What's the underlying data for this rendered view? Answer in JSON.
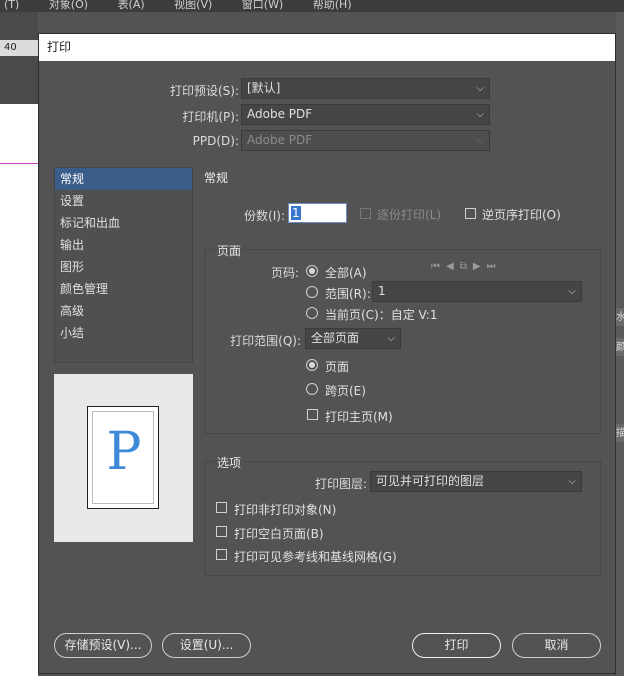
{
  "background": {
    "menu": [
      "(T)",
      "对象(O)",
      "表(A)",
      "视图(V)",
      "窗口(W)",
      "帮助(H)"
    ],
    "ruler_value": "40",
    "side_tabs": [
      "水",
      "颜",
      "描"
    ]
  },
  "dialog": {
    "title": "打印",
    "preset": {
      "label": "打印预设(S):",
      "value": "[默认]"
    },
    "printer": {
      "label": "打印机(P):",
      "value": "Adobe PDF"
    },
    "ppd": {
      "label": "PPD(D):",
      "value": "Adobe PDF"
    },
    "categories": [
      "常规",
      "设置",
      "标记和出血",
      "输出",
      "图形",
      "颜色管理",
      "高级",
      "小结"
    ],
    "selected_category": 0,
    "preview_letter": "P",
    "section_title": "常规",
    "copies": {
      "label": "份数(I):",
      "value": "1"
    },
    "collate": {
      "label": "逐份打印(L)",
      "checked": false,
      "disabled": true
    },
    "reverse": {
      "label": "逆页序打印(O)",
      "checked": false
    },
    "pages_group": {
      "title": "页面",
      "pages_label": "页码:",
      "all": "全部(A)",
      "range": "范围(R):",
      "range_value": "1",
      "current": "当前页(C)：自定 V:1",
      "print_range_label": "打印范围(Q):",
      "print_range_value": "全部页面",
      "pages_option": "页面",
      "spreads_option": "跨页(E)",
      "master_pages": "打印主页(M)"
    },
    "options_group": {
      "title": "选项",
      "layers_label": "打印图层:",
      "layers_value": "可见并可打印的图层",
      "non_printing": "打印非打印对象(N)",
      "blank_pages": "打印空白页面(B)",
      "guides": "打印可见参考线和基线网格(G)"
    },
    "buttons": {
      "save_preset": "存储预设(V)...",
      "setup": "设置(U)...",
      "print": "打印",
      "cancel": "取消"
    }
  }
}
